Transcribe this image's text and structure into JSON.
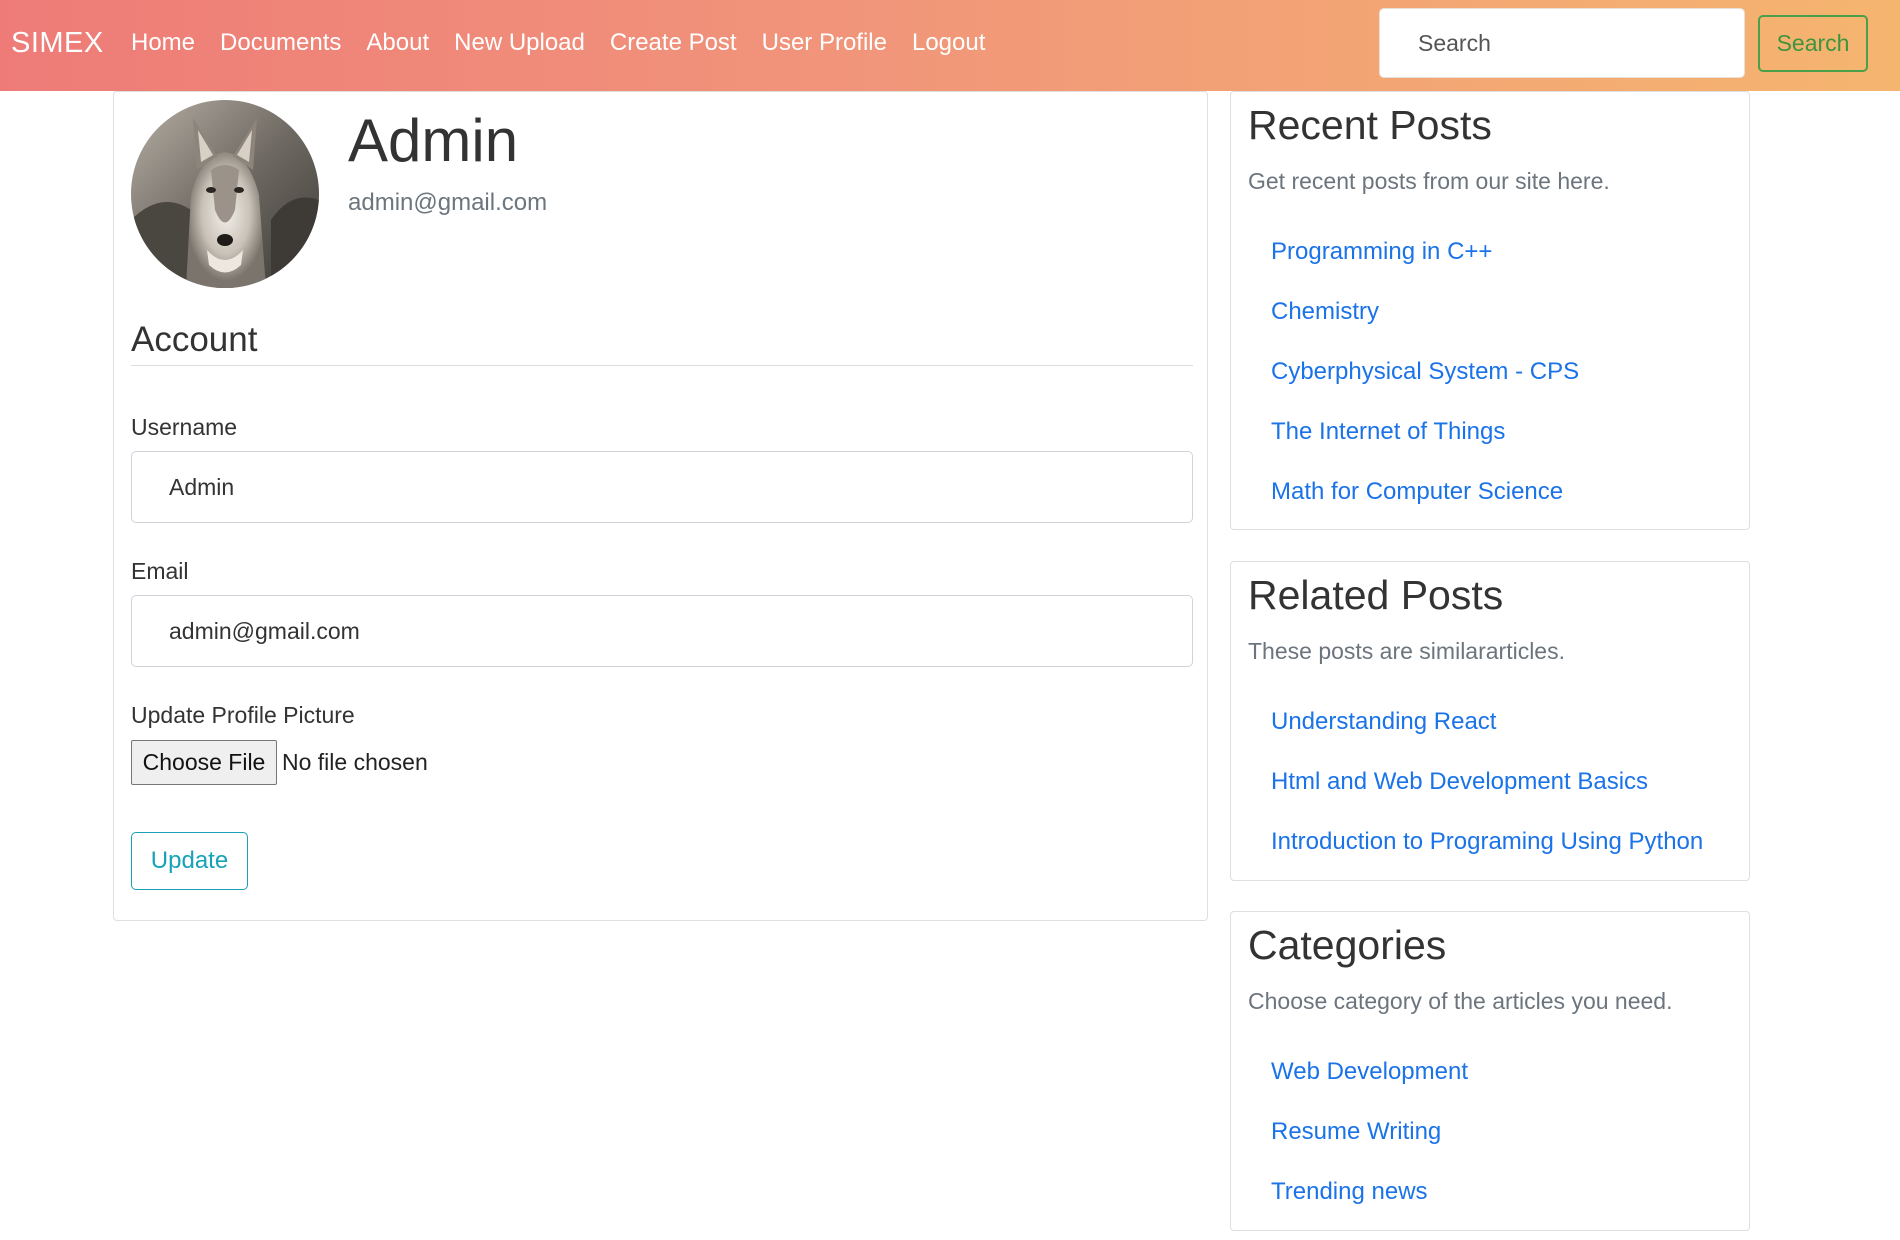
{
  "nav": {
    "brand": "SIMEX",
    "links": [
      "Home",
      "Documents",
      "About",
      "New Upload",
      "Create Post",
      "User Profile",
      "Logout"
    ],
    "search_placeholder": "Search",
    "search_button": "Search",
    "accent_color": "#ee7b78"
  },
  "profile": {
    "avatar_icon": "wolf-photo",
    "name": "Admin",
    "email": "admin@gmail.com",
    "section_title": "Account",
    "username_label": "Username",
    "username_value": "Admin",
    "email_label": "Email",
    "email_value": "admin@gmail.com",
    "picture_label": "Update Profile Picture",
    "choose_file": "Choose File",
    "no_file": "No file chosen",
    "update_button": "Update"
  },
  "sidebar": {
    "recent": {
      "title": "Recent Posts",
      "description": "Get recent posts from our site here.",
      "items": [
        "Programming in C++",
        "Chemistry",
        "Cyberphysical System - CPS",
        "The Internet of Things",
        "Math for Computer Science"
      ]
    },
    "related": {
      "title": "Related Posts",
      "description": "These posts are similararticles.",
      "items": [
        "Understanding React",
        "Html and Web Development Basics",
        "Introduction to Programing Using Python"
      ]
    },
    "categories": {
      "title": "Categories",
      "description": "Choose category of the articles you need.",
      "items": [
        "Web Development",
        "Resume Writing",
        "Trending news"
      ]
    }
  }
}
